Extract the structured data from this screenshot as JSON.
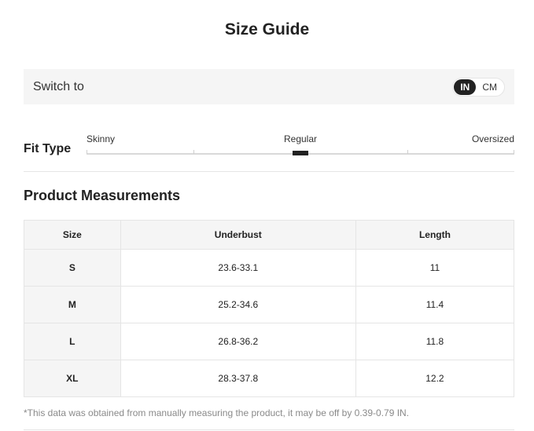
{
  "title": "Size Guide",
  "switch": {
    "label": "Switch to",
    "options": [
      "IN",
      "CM"
    ],
    "selected": "IN"
  },
  "fit_type": {
    "label": "Fit Type",
    "scale": [
      "Skinny",
      "Regular",
      "Oversized"
    ],
    "selected": "Regular"
  },
  "measurements": {
    "title": "Product Measurements",
    "headers": [
      "Size",
      "Underbust",
      "Length"
    ],
    "rows": [
      [
        "S",
        "23.6-33.1",
        "11"
      ],
      [
        "M",
        "25.2-34.6",
        "11.4"
      ],
      [
        "L",
        "26.8-36.2",
        "11.8"
      ],
      [
        "XL",
        "28.3-37.8",
        "12.2"
      ]
    ]
  },
  "note": "*This data was obtained from manually measuring the product, it may be off by 0.39-0.79 IN."
}
